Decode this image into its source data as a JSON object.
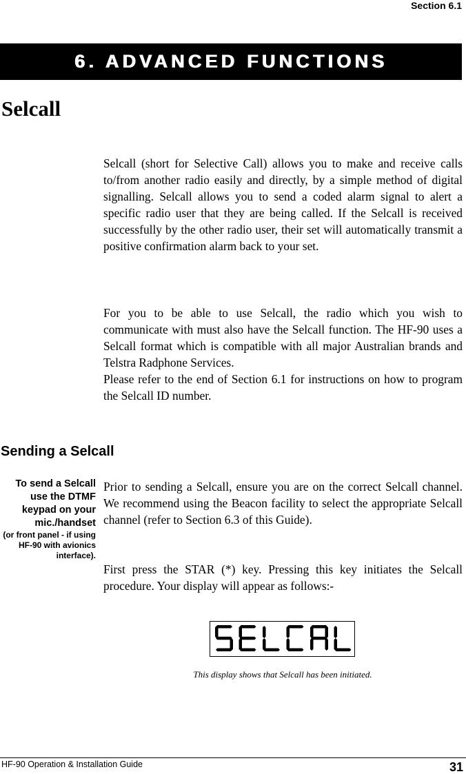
{
  "header": {
    "section": "Section 6.1",
    "chapter_title": "6. ADVANCED FUNCTIONS"
  },
  "main": {
    "heading": "Selcall",
    "intro_paragraphs": [
      "Selcall (short for Selective Call) allows you to make and receive calls to/from another radio easily and directly, by a simple method of digital signalling.  Selcall allows you to send a coded alarm signal to alert a specific radio user that they are being called.  If the Selcall is received successfully by the other radio user, their set will automatically transmit a positive confirmation alarm back to your set.",
      "For you to be able to use Selcall, the radio which you wish to communicate with must also have the Selcall function.  The HF-90 uses a Selcall format which is compatible with all major Australian brands and Telstra Radphone Services.",
      "Please refer to the end of Section 6.1 for instructions on how to program the Selcall ID number."
    ],
    "subheading": "Sending a Selcall",
    "side_note": {
      "primary": "To send a Selcall use the DTMF keypad on your mic./handset",
      "secondary": "(or front panel - if using HF-90 with avionics interface)."
    },
    "sending_paragraphs": [
      "Prior to sending a Selcall, ensure you are on the correct Selcall channel.  We recommend using the Beacon facility to select the appropriate Selcall channel (refer to Section 6.3 of this Guide).",
      "First press the STAR (*) key.  Pressing this key initiates the Selcall procedure.  Your display will appear as follows:-"
    ],
    "display": {
      "text": "SELCAL",
      "caption": "This display shows that Selcall has been initiated."
    }
  },
  "footer": {
    "guide_title": "HF-90 Operation & Installation Guide",
    "page_number": "31"
  }
}
